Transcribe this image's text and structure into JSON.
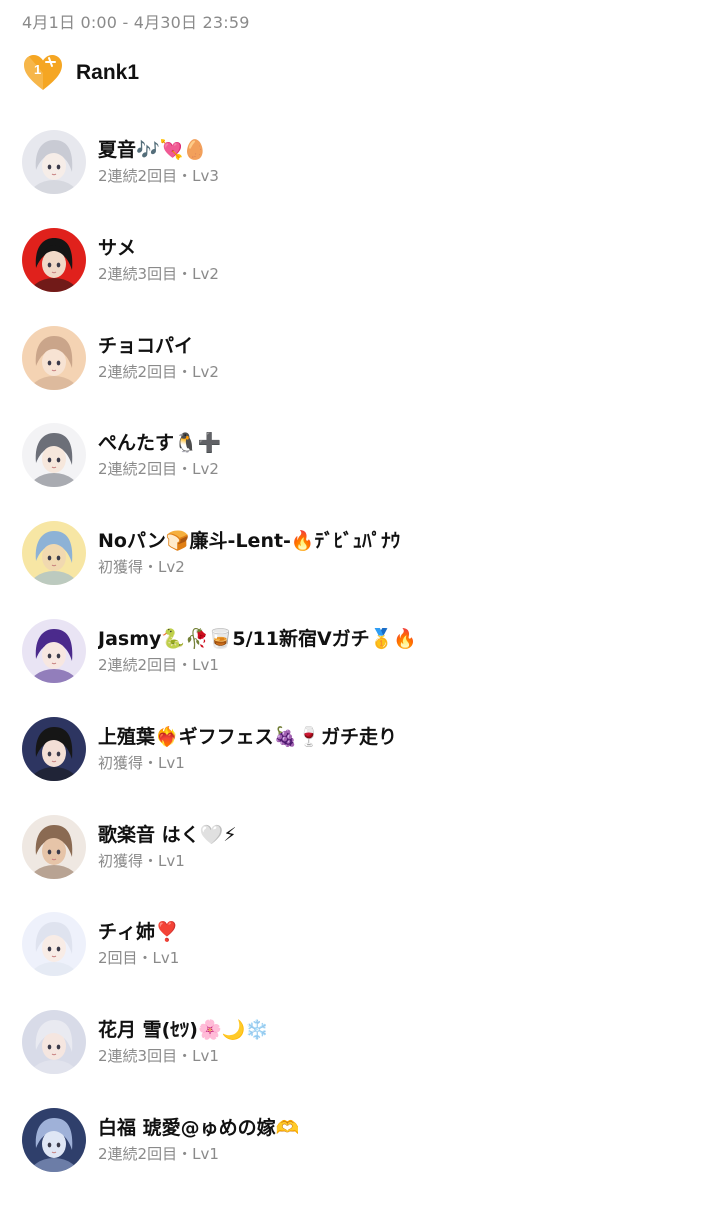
{
  "period": "4月1日 0:00 - 4月30日 23:59",
  "rank": {
    "badge_icon": "heart-rank-badge-icon",
    "badge_number": "1",
    "badge_color": "#f5a623",
    "label": "Rank1"
  },
  "colors": {
    "text_primary": "#111111",
    "text_secondary": "#8a8a8a",
    "background": "#ffffff"
  },
  "users": [
    {
      "name": "夏音🎶💘🥚",
      "status": "2連続2回目・Lv3",
      "avatar_icon": "silver-hair-girl-avatar-icon",
      "bg": "#e7e8ee",
      "hair": "#c9cbd4",
      "skin": "#f6ede8"
    },
    {
      "name": "サメ",
      "status": "2連続3回目・Lv2",
      "avatar_icon": "black-hair-boy-red-bg-avatar-icon",
      "bg": "#e0211c",
      "hair": "#151515",
      "skin": "#f1d9c8"
    },
    {
      "name": "チョコパイ",
      "status": "2連続2回目・Lv2",
      "avatar_icon": "horned-girl-avatar-icon",
      "bg": "#f4d3b3",
      "hair": "#caa58a",
      "skin": "#f7e3d3"
    },
    {
      "name": "ぺんたす🐧➕",
      "status": "2連続2回目・Lv2",
      "avatar_icon": "gray-hair-girl-avatar-icon",
      "bg": "#f3f3f5",
      "hair": "#6c6f78",
      "skin": "#f6e7dc"
    },
    {
      "name": "Noパン🍞廉斗-Lent-🔥ﾃﾞﾋﾞｭﾊﾟﾅｳ",
      "status": "初獲得・Lv2",
      "avatar_icon": "emoji-collage-avatar-icon",
      "bg": "#f7e6a4",
      "hair": "#8db2d6",
      "skin": "#f1d9b0"
    },
    {
      "name": "Jasmy🐍🥀🥃5/11新宿Vガチ🥇🔥",
      "status": "2連続2回目・Lv1",
      "avatar_icon": "purple-hair-girl-avatar-icon",
      "bg": "#e9e4f4",
      "hair": "#4b2a8c",
      "skin": "#f7e7e1"
    },
    {
      "name": "上殖葉❤️‍🔥ギフフェス🍇🍷ガチ走り",
      "status": "初獲得・Lv1",
      "avatar_icon": "night-sky-girl-avatar-icon",
      "bg": "#2d3561",
      "hair": "#161616",
      "skin": "#f3dfd6"
    },
    {
      "name": "歌楽音 はく🤍⚡",
      "status": "初獲得・Lv1",
      "avatar_icon": "brown-hair-boy-avatar-icon",
      "bg": "#efe8e2",
      "hair": "#8a6a52",
      "skin": "#e6c4a8"
    },
    {
      "name": "チィ姉❣️",
      "status": "2回目・Lv1",
      "avatar_icon": "bunny-ear-girl-avatar-icon",
      "bg": "#eef1fb",
      "hair": "#dfe3ef",
      "skin": "#f8ece6"
    },
    {
      "name": "花月 雪(ｾﾂ)🌸🌙❄️",
      "status": "2連続3回目・Lv1",
      "avatar_icon": "winking-girl-avatar-icon",
      "bg": "#d8dbe8",
      "hair": "#e9eaf1",
      "skin": "#f5e6e0"
    },
    {
      "name": "白福 琥愛@ゅめの嫁🫶",
      "status": "2連続2回目・Lv1",
      "avatar_icon": "blue-scene-avatar-icon",
      "bg": "#2f3f6b",
      "hair": "#9fb1d8",
      "skin": "#dfe6f5"
    }
  ]
}
